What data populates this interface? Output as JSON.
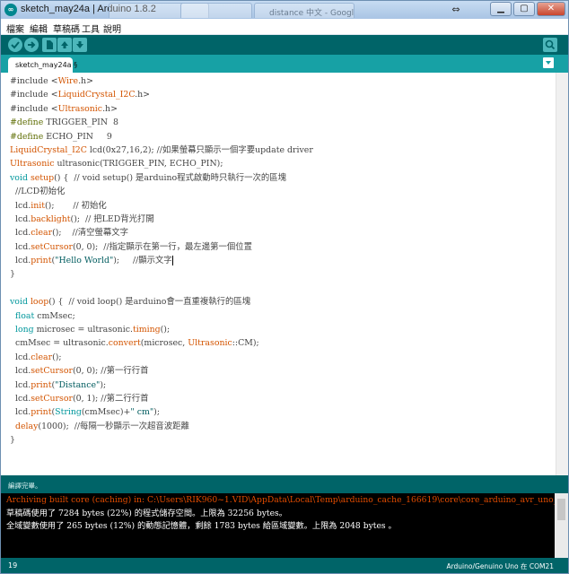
{
  "window": {
    "title": "sketch_may24a | Arduino 1.8.2",
    "background_tabs": [
      "",
      "",
      "distance 中文 - Google"
    ]
  },
  "menu": [
    "檔案",
    "編輯",
    "草稿碼",
    "工具",
    "說明"
  ],
  "toolbar": {
    "buttons": [
      "verify-icon",
      "upload-icon",
      "new-icon",
      "open-icon",
      "save-icon",
      "serial-monitor-icon"
    ]
  },
  "tab": {
    "label": "sketch_may24a §"
  },
  "code": [
    [
      [
        "#include <",
        "cm"
      ],
      [
        "Wire",
        "kw-lib"
      ],
      [
        ".h>",
        "cm"
      ]
    ],
    [
      [
        "#include <",
        "cm"
      ],
      [
        "LiquidCrystal_I2C",
        "kw-lib"
      ],
      [
        ".h>",
        "cm"
      ]
    ],
    [
      [
        "#include <",
        "cm"
      ],
      [
        "Ultrasonic",
        "kw-lib"
      ],
      [
        ".h>",
        "cm"
      ]
    ],
    [
      [
        "#define",
        "kw-pre"
      ],
      [
        " TRIGGER_PIN  8",
        "cm"
      ]
    ],
    [
      [
        "#define",
        "kw-pre"
      ],
      [
        " ECHO_PIN     9",
        "cm"
      ]
    ],
    [
      [
        "LiquidCrystal_I2C",
        "kw-lib"
      ],
      [
        " lcd(0x27,16,2); //如果螢幕只顯示一個字要update driver",
        "cm"
      ]
    ],
    [
      [
        "Ultrasonic",
        "kw-lib"
      ],
      [
        " ultrasonic(TRIGGER_PIN, ECHO_PIN);",
        "cm"
      ]
    ],
    [
      [
        "void",
        "kw-type"
      ],
      [
        " ",
        "cm"
      ],
      [
        "setup",
        "kw-fn"
      ],
      [
        "() {  // void setup() 是arduino程式啟動時只執行一次的區塊",
        "cm"
      ]
    ],
    [
      [
        "  //LCD初始化",
        "cm"
      ]
    ],
    [
      [
        "  lcd.",
        "cm"
      ],
      [
        "init",
        "kw-fn"
      ],
      [
        "();       // 初始化",
        "cm"
      ]
    ],
    [
      [
        "  lcd.",
        "cm"
      ],
      [
        "backlight",
        "kw-fn"
      ],
      [
        "();  // 把LED背光打開",
        "cm"
      ]
    ],
    [
      [
        "  lcd.",
        "cm"
      ],
      [
        "clear",
        "kw-fn"
      ],
      [
        "();    //清空螢幕文字",
        "cm"
      ]
    ],
    [
      [
        "  lcd.",
        "cm"
      ],
      [
        "setCursor",
        "kw-fn"
      ],
      [
        "(0, 0);  //指定顯示在第一行，最左邊第一個位置",
        "cm"
      ]
    ],
    [
      [
        "  lcd.",
        "cm"
      ],
      [
        "print",
        "kw-fn"
      ],
      [
        "(",
        "cm"
      ],
      [
        "\"Hello World\"",
        "str"
      ],
      [
        ");     //顯示文字",
        "cm"
      ]
    ],
    [
      [
        "}",
        "cm"
      ]
    ],
    [
      [
        "",
        "cm"
      ]
    ],
    [
      [
        "void",
        "kw-type"
      ],
      [
        " ",
        "cm"
      ],
      [
        "loop",
        "kw-fn"
      ],
      [
        "() {  // void loop() 是arduino會一直重複執行的區塊",
        "cm"
      ]
    ],
    [
      [
        "  ",
        "cm"
      ],
      [
        "float",
        "kw-type"
      ],
      [
        " cmMsec;",
        "cm"
      ]
    ],
    [
      [
        "  ",
        "cm"
      ],
      [
        "long",
        "kw-type"
      ],
      [
        " microsec = ultrasonic.",
        "cm"
      ],
      [
        "timing",
        "kw-fn"
      ],
      [
        "();",
        "cm"
      ]
    ],
    [
      [
        "  cmMsec = ultrasonic.",
        "cm"
      ],
      [
        "convert",
        "kw-fn"
      ],
      [
        "(microsec, ",
        "cm"
      ],
      [
        "Ultrasonic",
        "kw-lib"
      ],
      [
        "::CM);",
        "cm"
      ]
    ],
    [
      [
        "  lcd.",
        "cm"
      ],
      [
        "clear",
        "kw-fn"
      ],
      [
        "();",
        "cm"
      ]
    ],
    [
      [
        "  lcd.",
        "cm"
      ],
      [
        "setCursor",
        "kw-fn"
      ],
      [
        "(0, 0); //第一行行首",
        "cm"
      ]
    ],
    [
      [
        "  lcd.",
        "cm"
      ],
      [
        "print",
        "kw-fn"
      ],
      [
        "(",
        "cm"
      ],
      [
        "\"Distance\"",
        "str"
      ],
      [
        ");",
        "cm"
      ]
    ],
    [
      [
        "  lcd.",
        "cm"
      ],
      [
        "setCursor",
        "kw-fn"
      ],
      [
        "(0, 1); //第二行行首",
        "cm"
      ]
    ],
    [
      [
        "  lcd.",
        "cm"
      ],
      [
        "print",
        "kw-fn"
      ],
      [
        "(",
        "cm"
      ],
      [
        "String",
        "kw-type"
      ],
      [
        "(cmMsec)+",
        "cm"
      ],
      [
        "\" cm\"",
        "str"
      ],
      [
        ");",
        "cm"
      ]
    ],
    [
      [
        "  ",
        "cm"
      ],
      [
        "delay",
        "kw-fn"
      ],
      [
        "(1000);  //每隔一秒顯示一次超音波距離",
        "cm"
      ]
    ],
    [
      [
        "}",
        "cm"
      ]
    ]
  ],
  "console": {
    "status": "編譯完畢。",
    "lines": [
      [
        "Archiving built core (caching) in: C:\\Users\\RIK960~1.VID\\AppData\\Local\\Temp\\arduino_cache_166619\\core\\core_arduino_avr_uno_",
        "c-orange"
      ],
      [
        "草稿碼使用了 7284 bytes (22%) 的程式儲存空間。上限為 32256 bytes。",
        "c-white"
      ],
      [
        "全域變數使用了 265 bytes (12%) 的動態記憶體，剩餘 1783 bytes 給區域變數。上限為 2048 bytes 。",
        "c-white"
      ]
    ]
  },
  "statusbar": {
    "line": "19",
    "board": "Arduino/Genuino Uno 在 COM21"
  }
}
